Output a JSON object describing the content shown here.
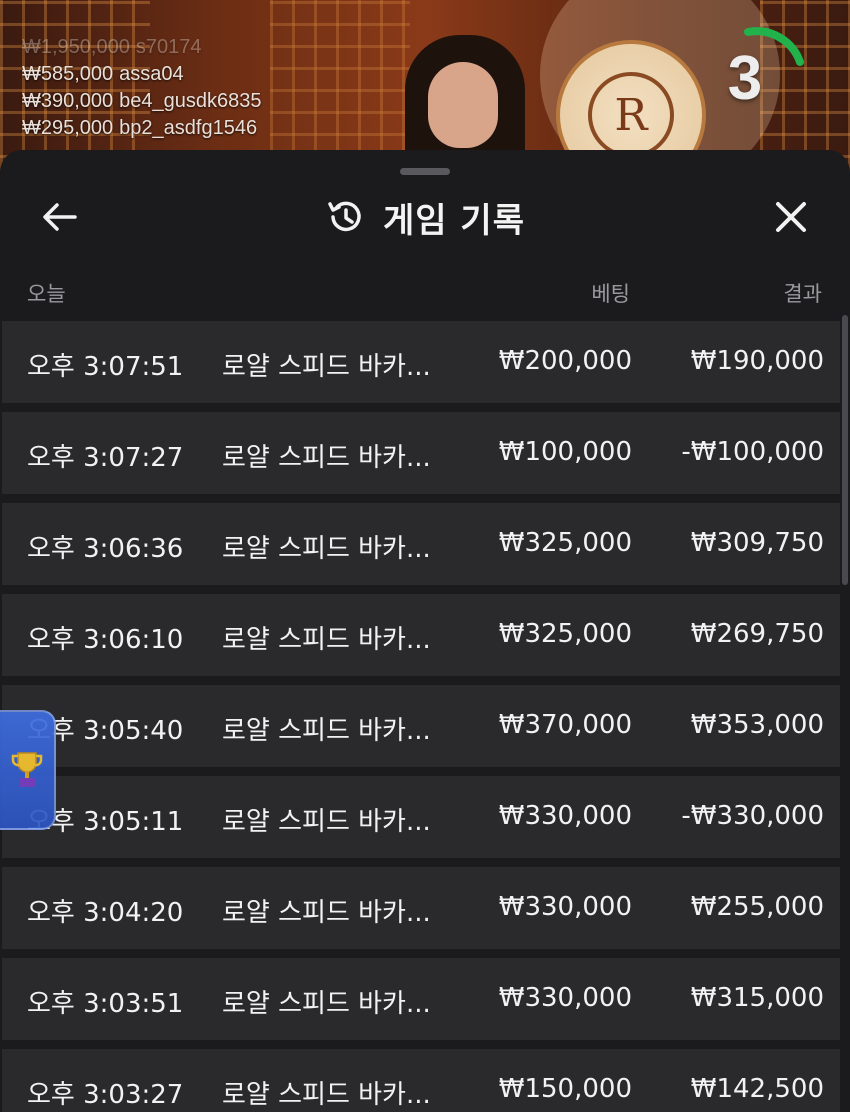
{
  "live_feed": {
    "bets": [
      {
        "amount": "₩1,950,000",
        "user": "s70174"
      },
      {
        "amount": "₩585,000",
        "user": "assa04"
      },
      {
        "amount": "₩390,000",
        "user": "be4_gusdk6835"
      },
      {
        "amount": "₩295,000",
        "user": "bp2_asdfg1546"
      }
    ],
    "countdown": "3",
    "table_logo": "R",
    "colors": {
      "timer_arc": "#22b24c"
    }
  },
  "sheet": {
    "title": "게임 기록",
    "icons": {
      "back": "arrow-left-icon",
      "history": "history-clock-icon",
      "close": "close-x-icon"
    },
    "columns": {
      "today": "오늘",
      "bet": "베팅",
      "result": "결과"
    },
    "rows": [
      {
        "time": "오후 3:07:51",
        "game": "로얄 스피드 바카...",
        "bet": "₩200,000",
        "result": "₩190,000"
      },
      {
        "time": "오후 3:07:27",
        "game": "로얄 스피드 바카...",
        "bet": "₩100,000",
        "result": "-₩100,000"
      },
      {
        "time": "오후 3:06:36",
        "game": "로얄 스피드 바카...",
        "bet": "₩325,000",
        "result": "₩309,750"
      },
      {
        "time": "오후 3:06:10",
        "game": "로얄 스피드 바카...",
        "bet": "₩325,000",
        "result": "₩269,750"
      },
      {
        "time": "오후 3:05:40",
        "game": "로얄 스피드 바카...",
        "bet": "₩370,000",
        "result": "₩353,000"
      },
      {
        "time": "오후 3:05:11",
        "game": "로얄 스피드 바카...",
        "bet": "₩330,000",
        "result": "-₩330,000"
      },
      {
        "time": "오후 3:04:20",
        "game": "로얄 스피드 바카...",
        "bet": "₩330,000",
        "result": "₩255,000"
      },
      {
        "time": "오후 3:03:51",
        "game": "로얄 스피드 바카...",
        "bet": "₩330,000",
        "result": "₩315,000"
      },
      {
        "time": "오후 3:03:27",
        "game": "로얄 스피드 바카...",
        "bet": "₩150,000",
        "result": "₩142,500"
      }
    ],
    "colors": {
      "background": "#1b1b1d",
      "row": "#2a2a2d",
      "text": "#f2f2f2",
      "muted": "#9a9a9e"
    }
  },
  "trophy_widget": {
    "icon": "trophy-icon",
    "color": "#3f6ee0"
  }
}
